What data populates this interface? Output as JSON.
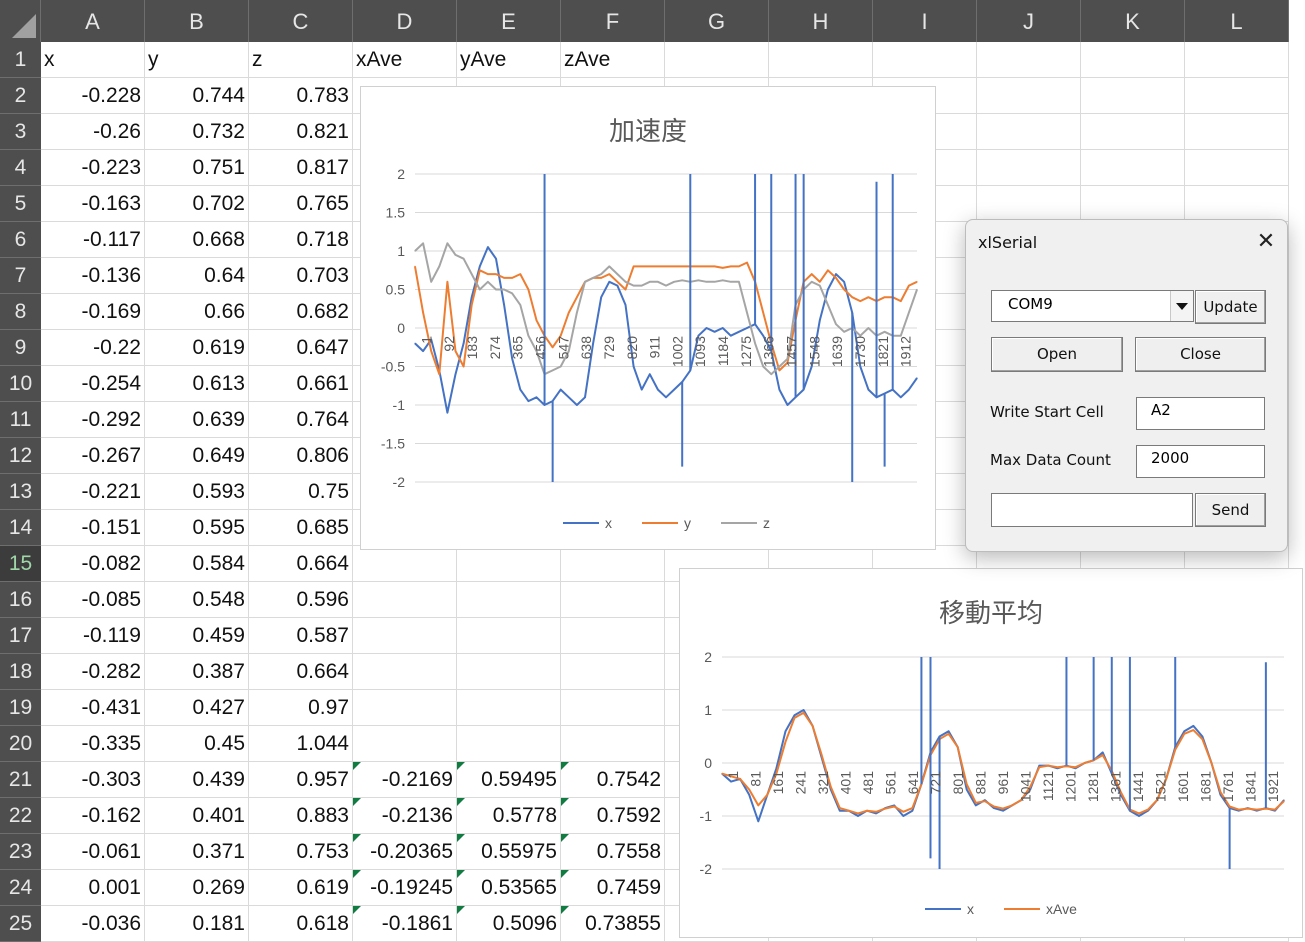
{
  "columns": [
    "A",
    "B",
    "C",
    "D",
    "E",
    "F",
    "G",
    "H",
    "I",
    "J",
    "K",
    "L"
  ],
  "selected_row": "15",
  "rows": [
    {
      "n": "1",
      "a": "x",
      "b": "y",
      "c": "z",
      "d": "xAve",
      "e": "yAve",
      "f": "zAve"
    },
    {
      "n": "2",
      "a": "-0.228",
      "b": "0.744",
      "c": "0.783"
    },
    {
      "n": "3",
      "a": "-0.26",
      "b": "0.732",
      "c": "0.821"
    },
    {
      "n": "4",
      "a": "-0.223",
      "b": "0.751",
      "c": "0.817"
    },
    {
      "n": "5",
      "a": "-0.163",
      "b": "0.702",
      "c": "0.765"
    },
    {
      "n": "6",
      "a": "-0.117",
      "b": "0.668",
      "c": "0.718"
    },
    {
      "n": "7",
      "a": "-0.136",
      "b": "0.64",
      "c": "0.703"
    },
    {
      "n": "8",
      "a": "-0.169",
      "b": "0.66",
      "c": "0.682"
    },
    {
      "n": "9",
      "a": "-0.22",
      "b": "0.619",
      "c": "0.647"
    },
    {
      "n": "10",
      "a": "-0.254",
      "b": "0.613",
      "c": "0.661"
    },
    {
      "n": "11",
      "a": "-0.292",
      "b": "0.639",
      "c": "0.764"
    },
    {
      "n": "12",
      "a": "-0.267",
      "b": "0.649",
      "c": "0.806"
    },
    {
      "n": "13",
      "a": "-0.221",
      "b": "0.593",
      "c": "0.75"
    },
    {
      "n": "14",
      "a": "-0.151",
      "b": "0.595",
      "c": "0.685"
    },
    {
      "n": "15",
      "a": "-0.082",
      "b": "0.584",
      "c": "0.664"
    },
    {
      "n": "16",
      "a": "-0.085",
      "b": "0.548",
      "c": "0.596"
    },
    {
      "n": "17",
      "a": "-0.119",
      "b": "0.459",
      "c": "0.587"
    },
    {
      "n": "18",
      "a": "-0.282",
      "b": "0.387",
      "c": "0.664"
    },
    {
      "n": "19",
      "a": "-0.431",
      "b": "0.427",
      "c": "0.97"
    },
    {
      "n": "20",
      "a": "-0.335",
      "b": "0.45",
      "c": "1.044"
    },
    {
      "n": "21",
      "a": "-0.303",
      "b": "0.439",
      "c": "0.957",
      "d": "-0.2169",
      "e": "0.59495",
      "f": "0.7542"
    },
    {
      "n": "22",
      "a": "-0.162",
      "b": "0.401",
      "c": "0.883",
      "d": "-0.2136",
      "e": "0.5778",
      "f": "0.7592"
    },
    {
      "n": "23",
      "a": "-0.061",
      "b": "0.371",
      "c": "0.753",
      "d": "-0.20365",
      "e": "0.55975",
      "f": "0.7558"
    },
    {
      "n": "24",
      "a": "0.001",
      "b": "0.269",
      "c": "0.619",
      "d": "-0.19245",
      "e": "0.53565",
      "f": "0.7459"
    },
    {
      "n": "25",
      "a": "-0.036",
      "b": "0.181",
      "c": "0.618",
      "d": "-0.1861",
      "e": "0.5096",
      "f": "0.73855"
    }
  ],
  "chart_data": [
    {
      "type": "line",
      "title": "加速度",
      "ylim": [
        -2,
        2
      ],
      "yticks": [
        "2",
        "1.5",
        "1",
        "0.5",
        "0",
        "-0.5",
        "-1",
        "-1.5",
        "-2"
      ],
      "xticks": [
        "1",
        "92",
        "183",
        "274",
        "365",
        "456",
        "547",
        "638",
        "729",
        "820",
        "911",
        "1002",
        "1093",
        "1184",
        "1275",
        "1366",
        "1457",
        "1548",
        "1639",
        "1730",
        "1821",
        "1912"
      ],
      "grid": true,
      "legend_position": "bottom",
      "series": [
        {
          "name": "x",
          "color": "#4472c4",
          "values": [
            -0.2,
            -0.3,
            -0.15,
            -0.55,
            -1.1,
            -0.6,
            -0.2,
            0.4,
            0.8,
            1.05,
            0.9,
            0.3,
            -0.4,
            -0.8,
            -0.95,
            -0.9,
            -1.0,
            -0.95,
            -0.8,
            -0.9,
            -1.0,
            -0.9,
            -0.2,
            0.4,
            0.6,
            0.55,
            0.3,
            -0.5,
            -0.8,
            -0.6,
            -0.8,
            -0.9,
            -0.8,
            -0.7,
            -0.55,
            -0.1,
            0.0,
            -0.05,
            0.0,
            -0.1,
            -0.05,
            0.0,
            0.05,
            -0.1,
            -0.3,
            -0.8,
            -1.0,
            -0.9,
            -0.8,
            -0.5,
            0.1,
            0.5,
            0.7,
            0.6,
            0.2,
            -0.5,
            -0.8,
            -0.9,
            -0.85,
            -0.8,
            -0.9,
            -0.8,
            -0.65
          ]
        },
        {
          "name": "y",
          "color": "#ed7d31",
          "values": [
            0.8,
            0.2,
            -0.3,
            -0.6,
            0.6,
            -0.3,
            -0.5,
            0.3,
            0.75,
            0.7,
            0.7,
            0.65,
            0.65,
            0.7,
            0.5,
            0.1,
            -0.1,
            -0.25,
            -0.1,
            0.2,
            0.4,
            0.6,
            0.65,
            0.65,
            0.7,
            0.6,
            0.5,
            0.8,
            0.8,
            0.8,
            0.8,
            0.8,
            0.8,
            0.8,
            0.8,
            0.8,
            0.8,
            0.8,
            0.78,
            0.8,
            0.8,
            0.85,
            0.6,
            0.2,
            -0.2,
            -0.55,
            -0.45,
            0.1,
            0.6,
            0.7,
            0.6,
            0.75,
            0.65,
            0.5,
            0.4,
            0.35,
            0.4,
            0.35,
            0.4,
            0.4,
            0.35,
            0.55,
            0.6
          ]
        },
        {
          "name": "z",
          "color": "#a5a5a5",
          "values": [
            1.0,
            1.1,
            0.6,
            0.8,
            1.1,
            0.95,
            0.9,
            0.7,
            0.5,
            0.6,
            0.5,
            0.5,
            0.45,
            0.3,
            -0.1,
            -0.3,
            -0.6,
            -0.55,
            -0.5,
            -0.3,
            0.2,
            0.6,
            0.65,
            0.7,
            0.8,
            0.7,
            0.6,
            0.55,
            0.55,
            0.6,
            0.6,
            0.55,
            0.6,
            0.62,
            0.6,
            0.62,
            0.6,
            0.6,
            0.62,
            0.6,
            0.6,
            0.2,
            -0.2,
            -0.5,
            -0.6,
            -0.5,
            -0.4,
            0.3,
            0.5,
            0.6,
            0.55,
            0.3,
            0.05,
            -0.05,
            0.0,
            -0.1,
            0.0,
            -0.1,
            -0.05,
            -0.1,
            -0.1,
            0.2,
            0.5
          ]
        }
      ],
      "spikes": [
        {
          "series": "x",
          "index": 16,
          "value": 2
        },
        {
          "series": "x",
          "index": 17,
          "value": -2
        },
        {
          "series": "x",
          "index": 33,
          "value": -1.8
        },
        {
          "series": "x",
          "index": 34,
          "value": 2
        },
        {
          "series": "x",
          "index": 42,
          "value": 2
        },
        {
          "series": "x",
          "index": 44,
          "value": 2
        },
        {
          "series": "x",
          "index": 47,
          "value": 2
        },
        {
          "series": "x",
          "index": 48,
          "value": 2
        },
        {
          "series": "x",
          "index": 54,
          "value": -2
        },
        {
          "series": "x",
          "index": 57,
          "value": 1.9
        },
        {
          "series": "x",
          "index": 58,
          "value": -1.8
        },
        {
          "series": "x",
          "index": 59,
          "value": 2
        }
      ]
    },
    {
      "type": "line",
      "title": "移動平均",
      "ylim": [
        -2,
        2
      ],
      "yticks": [
        "2",
        "1",
        "0",
        "-1",
        "-2"
      ],
      "xticks": [
        "1",
        "81",
        "161",
        "241",
        "321",
        "401",
        "481",
        "561",
        "641",
        "721",
        "801",
        "881",
        "961",
        "1041",
        "1121",
        "1201",
        "1281",
        "1361",
        "1441",
        "1521",
        "1601",
        "1681",
        "1761",
        "1841",
        "1921"
      ],
      "grid": true,
      "legend_position": "bottom",
      "series": [
        {
          "name": "x",
          "color": "#4472c4",
          "values": [
            -0.2,
            -0.35,
            -0.3,
            -0.6,
            -1.1,
            -0.6,
            -0.1,
            0.6,
            0.9,
            1.0,
            0.7,
            0.1,
            -0.5,
            -0.9,
            -0.9,
            -1.0,
            -0.9,
            -0.95,
            -0.85,
            -0.8,
            -1.0,
            -0.9,
            -0.4,
            0.2,
            0.5,
            0.6,
            0.3,
            -0.5,
            -0.8,
            -0.7,
            -0.85,
            -0.9,
            -0.8,
            -0.7,
            -0.5,
            -0.05,
            -0.05,
            -0.1,
            -0.05,
            -0.1,
            0.0,
            0.05,
            0.2,
            -0.2,
            -0.6,
            -0.9,
            -1.0,
            -0.9,
            -0.7,
            -0.3,
            0.3,
            0.6,
            0.7,
            0.5,
            0.0,
            -0.6,
            -0.85,
            -0.9,
            -0.85,
            -0.9,
            -0.85,
            -0.9,
            -0.7
          ]
        },
        {
          "name": "xAve",
          "color": "#ed7d31",
          "values": [
            -0.2,
            -0.25,
            -0.3,
            -0.5,
            -0.8,
            -0.6,
            -0.2,
            0.4,
            0.85,
            0.95,
            0.7,
            0.15,
            -0.45,
            -0.85,
            -0.9,
            -0.95,
            -0.9,
            -0.92,
            -0.86,
            -0.82,
            -0.92,
            -0.85,
            -0.4,
            0.15,
            0.45,
            0.55,
            0.3,
            -0.4,
            -0.75,
            -0.72,
            -0.82,
            -0.86,
            -0.8,
            -0.7,
            -0.45,
            -0.08,
            -0.05,
            -0.08,
            -0.06,
            -0.08,
            0.0,
            0.05,
            0.15,
            -0.15,
            -0.55,
            -0.88,
            -0.95,
            -0.88,
            -0.7,
            -0.3,
            0.25,
            0.55,
            0.62,
            0.45,
            0.0,
            -0.55,
            -0.82,
            -0.88,
            -0.86,
            -0.88,
            -0.86,
            -0.88,
            -0.72
          ]
        }
      ],
      "spikes": [
        {
          "series": "x",
          "index": 22,
          "value": 2
        },
        {
          "series": "x",
          "index": 23,
          "value": 2
        },
        {
          "series": "x",
          "index": 23,
          "value": -1.8
        },
        {
          "series": "x",
          "index": 24,
          "value": -2
        },
        {
          "series": "x",
          "index": 38,
          "value": 2
        },
        {
          "series": "x",
          "index": 41,
          "value": 2
        },
        {
          "series": "x",
          "index": 43,
          "value": 2
        },
        {
          "series": "x",
          "index": 45,
          "value": 2
        },
        {
          "series": "x",
          "index": 50,
          "value": 2
        },
        {
          "series": "x",
          "index": 56,
          "value": -2
        },
        {
          "series": "x",
          "index": 60,
          "value": 1.9
        }
      ]
    }
  ],
  "dialog": {
    "title": "xlSerial",
    "close": "✕",
    "port": "COM9",
    "update_label": "Update",
    "open_label": "Open",
    "close_label": "Close",
    "write_start_label": "Write Start Cell",
    "write_start_value": "A2",
    "max_count_label": "Max Data Count",
    "max_count_value": "2000",
    "send_value": "",
    "send_label": "Send"
  }
}
